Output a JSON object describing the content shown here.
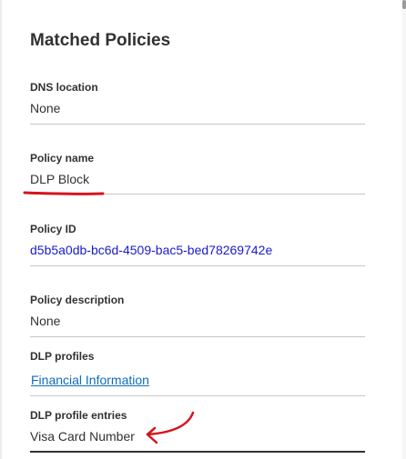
{
  "panel": {
    "title": "Matched Policies"
  },
  "fields": [
    {
      "label": "DNS location",
      "value": "None"
    },
    {
      "label": "Policy name",
      "value": "DLP Block"
    },
    {
      "label": "Policy ID",
      "value": "d5b5a0db-bc6d-4509-bac5-bed78269742e"
    },
    {
      "label": "Policy description",
      "value": "None"
    },
    {
      "label": "DLP profiles",
      "value": "Financial Information"
    },
    {
      "label": "DLP profile entries",
      "value": "Visa Card Number"
    }
  ],
  "colors": {
    "annotation": "#d6141c",
    "link": "#0f6cbd",
    "policy_id": "#1a1acc"
  }
}
